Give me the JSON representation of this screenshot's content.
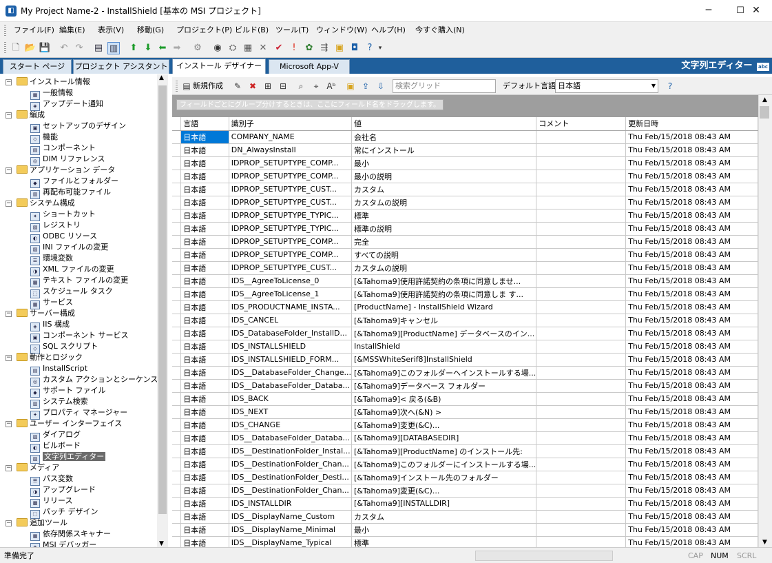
{
  "window": {
    "title": "My Project Name-2 - InstallShield [基本の MSI プロジェクト]",
    "minimize": "─",
    "maximize": "☐",
    "close": "✕"
  },
  "menu": [
    "ファイル(F)",
    "編集(E)",
    "表示(V)",
    "移動(G)",
    "プロジェクト(P)",
    "ビルド(B)",
    "ツール(T)",
    "ウィンドウ(W)",
    "ヘルプ(H)",
    "今すぐ購入(N)"
  ],
  "tabs": [
    "スタート ページ",
    "プロジェクト アシスタント",
    "インストール デザイナー",
    "Microsoft App-V"
  ],
  "editor_title": "文字列エディター",
  "tree": {
    "groups": [
      {
        "label": "インストール情報",
        "items": [
          "一般情報",
          "アップデート通知"
        ]
      },
      {
        "label": "編成",
        "items": [
          "セットアップのデザイン",
          "機能",
          "コンポーネント",
          "DIM リファレンス"
        ]
      },
      {
        "label": "アプリケーション データ",
        "items": [
          "ファイルとフォルダー",
          "再配布可能ファイル"
        ]
      },
      {
        "label": "システム構成",
        "items": [
          "ショートカット",
          "レジストリ",
          "ODBC リソース",
          "INI ファイルの変更",
          "環境変数",
          "XML ファイルの変更",
          "テキスト ファイルの変更",
          "スケジュール タスク",
          "サービス"
        ]
      },
      {
        "label": "サーバー構成",
        "items": [
          "IIS 構成",
          "コンポーネント サービス",
          "SQL スクリプト"
        ]
      },
      {
        "label": "動作とロジック",
        "items": [
          "InstallScript",
          "カスタム アクションとシーケンス",
          "サポート ファイル",
          "システム検索",
          "プロパティ マネージャー"
        ]
      },
      {
        "label": "ユーザー インターフェイス",
        "items": [
          "ダイアログ",
          "ビルボード",
          "文字列エディター"
        ]
      },
      {
        "label": "メディア",
        "items": [
          "パス変数",
          "アップグレード",
          "リリース",
          "パッチ デザイン"
        ]
      },
      {
        "label": "追加ツール",
        "items": [
          "依存関係スキャナー",
          "MSI デバッガー"
        ]
      }
    ],
    "selected": "文字列エディター"
  },
  "editor_toolbar": {
    "new_label": "新規作成",
    "search_placeholder": "検索グリッド",
    "default_lang_label": "デフォルト言語:",
    "default_lang_value": "日本語"
  },
  "group_hint": "フィールドごとにグループ分けするときは、ここにフィールド名をドラッグします。",
  "grid": {
    "columns": [
      "言語",
      "識別子",
      "値",
      "コメント",
      "更新日時"
    ],
    "rows": [
      [
        "日本語",
        "COMPANY_NAME",
        "会社名",
        "",
        "Thu Feb/15/2018 08:43 AM"
      ],
      [
        "日本語",
        "DN_AlwaysInstall",
        "常にインストール",
        "",
        "Thu Feb/15/2018 08:43 AM"
      ],
      [
        "日本語",
        "IDPROP_SETUPTYPE_COMP...",
        "最小",
        "",
        "Thu Feb/15/2018 08:43 AM"
      ],
      [
        "日本語",
        "IDPROP_SETUPTYPE_COMP...",
        "最小の説明",
        "",
        "Thu Feb/15/2018 08:43 AM"
      ],
      [
        "日本語",
        "IDPROP_SETUPTYPE_CUST...",
        "カスタム",
        "",
        "Thu Feb/15/2018 08:43 AM"
      ],
      [
        "日本語",
        "IDPROP_SETUPTYPE_CUST...",
        "カスタムの説明",
        "",
        "Thu Feb/15/2018 08:43 AM"
      ],
      [
        "日本語",
        "IDPROP_SETUPTYPE_TYPIC...",
        "標準",
        "",
        "Thu Feb/15/2018 08:43 AM"
      ],
      [
        "日本語",
        "IDPROP_SETUPTYPE_TYPIC...",
        "標準の説明",
        "",
        "Thu Feb/15/2018 08:43 AM"
      ],
      [
        "日本語",
        "IDPROP_SETUPTYPE_COMP...",
        "完全",
        "",
        "Thu Feb/15/2018 08:43 AM"
      ],
      [
        "日本語",
        "IDPROP_SETUPTYPE_COMP...",
        "すべての説明",
        "",
        "Thu Feb/15/2018 08:43 AM"
      ],
      [
        "日本語",
        "IDPROP_SETUPTYPE_CUST...",
        "カスタムの説明",
        "",
        "Thu Feb/15/2018 08:43 AM"
      ],
      [
        "日本語",
        "IDS__AgreeToLicense_0",
        "[&Tahoma9]使用許諾契約の条項に同意しませ...",
        "",
        "Thu Feb/15/2018 08:43 AM"
      ],
      [
        "日本語",
        "IDS__AgreeToLicense_1",
        "[&Tahoma9]使用許諾契約の条項に同意しま す...",
        "",
        "Thu Feb/15/2018 08:43 AM"
      ],
      [
        "日本語",
        "IDS_PRODUCTNAME_INSTA...",
        "[ProductName] - InstallShield Wizard",
        "",
        "Thu Feb/15/2018 08:43 AM"
      ],
      [
        "日本語",
        "IDS_CANCEL",
        "[&Tahoma9]キャンセル",
        "",
        "Thu Feb/15/2018 08:43 AM"
      ],
      [
        "日本語",
        "IDS_DatabaseFolder_InstallD...",
        "[&Tahoma9][ProductName] データベースのイン...",
        "",
        "Thu Feb/15/2018 08:43 AM"
      ],
      [
        "日本語",
        "IDS_INSTALLSHIELD",
        "InstallShield",
        "",
        "Thu Feb/15/2018 08:43 AM"
      ],
      [
        "日本語",
        "IDS_INSTALLSHIELD_FORM...",
        "[&MSSWhiteSerif8]InstallShield",
        "",
        "Thu Feb/15/2018 08:43 AM"
      ],
      [
        "日本語",
        "IDS__DatabaseFolder_Change...",
        "[&Tahoma9]このフォルダーへインストールする場...",
        "",
        "Thu Feb/15/2018 08:43 AM"
      ],
      [
        "日本語",
        "IDS__DatabaseFolder_Databa...",
        "[&Tahoma9]データベース フォルダー",
        "",
        "Thu Feb/15/2018 08:43 AM"
      ],
      [
        "日本語",
        "IDS_BACK",
        "[&Tahoma9]< 戻る(&B)",
        "",
        "Thu Feb/15/2018 08:43 AM"
      ],
      [
        "日本語",
        "IDS_NEXT",
        "[&Tahoma9]次へ(&N) >",
        "",
        "Thu Feb/15/2018 08:43 AM"
      ],
      [
        "日本語",
        "IDS_CHANGE",
        "[&Tahoma9]変更(&C)...",
        "",
        "Thu Feb/15/2018 08:43 AM"
      ],
      [
        "日本語",
        "IDS__DatabaseFolder_Databa...",
        "[&Tahoma9][DATABASEDIR]",
        "",
        "Thu Feb/15/2018 08:43 AM"
      ],
      [
        "日本語",
        "IDS__DestinationFolder_Instal...",
        "[&Tahoma9][ProductName] のインストール先:",
        "",
        "Thu Feb/15/2018 08:43 AM"
      ],
      [
        "日本語",
        "IDS__DestinationFolder_Chan...",
        "[&Tahoma9]このフォルダーにインストールする場...",
        "",
        "Thu Feb/15/2018 08:43 AM"
      ],
      [
        "日本語",
        "IDS__DestinationFolder_Desti...",
        "[&Tahoma9]インストール先のフォルダー",
        "",
        "Thu Feb/15/2018 08:43 AM"
      ],
      [
        "日本語",
        "IDS__DestinationFolder_Chan...",
        "[&Tahoma9]変更(&C)...",
        "",
        "Thu Feb/15/2018 08:43 AM"
      ],
      [
        "日本語",
        "IDS_INSTALLDIR",
        "[&Tahoma9][INSTALLDIR]",
        "",
        "Thu Feb/15/2018 08:43 AM"
      ],
      [
        "日本語",
        "IDS__DisplayName_Custom",
        "カスタム",
        "",
        "Thu Feb/15/2018 08:43 AM"
      ],
      [
        "日本語",
        "IDS__DisplayName_Minimal",
        "最小",
        "",
        "Thu Feb/15/2018 08:43 AM"
      ],
      [
        "日本語",
        "IDS__DisplayName_Typical",
        "標準",
        "",
        "Thu Feb/15/2018 08:43 AM"
      ]
    ]
  },
  "status": {
    "text": "準備完了",
    "cap": "CAP",
    "num": "NUM",
    "scrl": "SCRL"
  }
}
